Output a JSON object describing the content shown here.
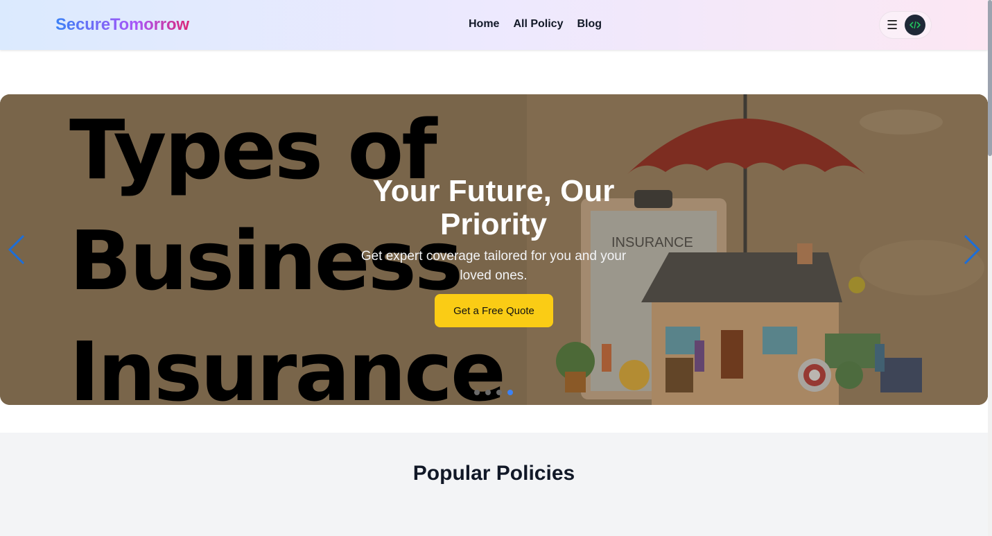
{
  "brand": {
    "name": "SecureTomorrow"
  },
  "nav": {
    "links": [
      {
        "label": "Home"
      },
      {
        "label": "All Policy"
      },
      {
        "label": "Blog"
      }
    ],
    "menu_icon": "hamburger-icon",
    "avatar_icon": "user-avatar"
  },
  "hero": {
    "image_title": "Types of Business Insurance",
    "image_title_lines": [
      "Types of",
      "Business",
      "Insurance"
    ],
    "heading": "Your Future, Our Priority",
    "subtext": "Get expert coverage tailored for you and your loved ones.",
    "cta_label": "Get a Free Quote",
    "insurance_label": "INSURANCE",
    "slide_count": 4,
    "active_slide": 4
  },
  "popular": {
    "title": "Popular Policies"
  },
  "colors": {
    "accent_yellow": "#facc15",
    "arrow_blue": "#1d6ed8",
    "active_dot": "#3b82f6"
  }
}
